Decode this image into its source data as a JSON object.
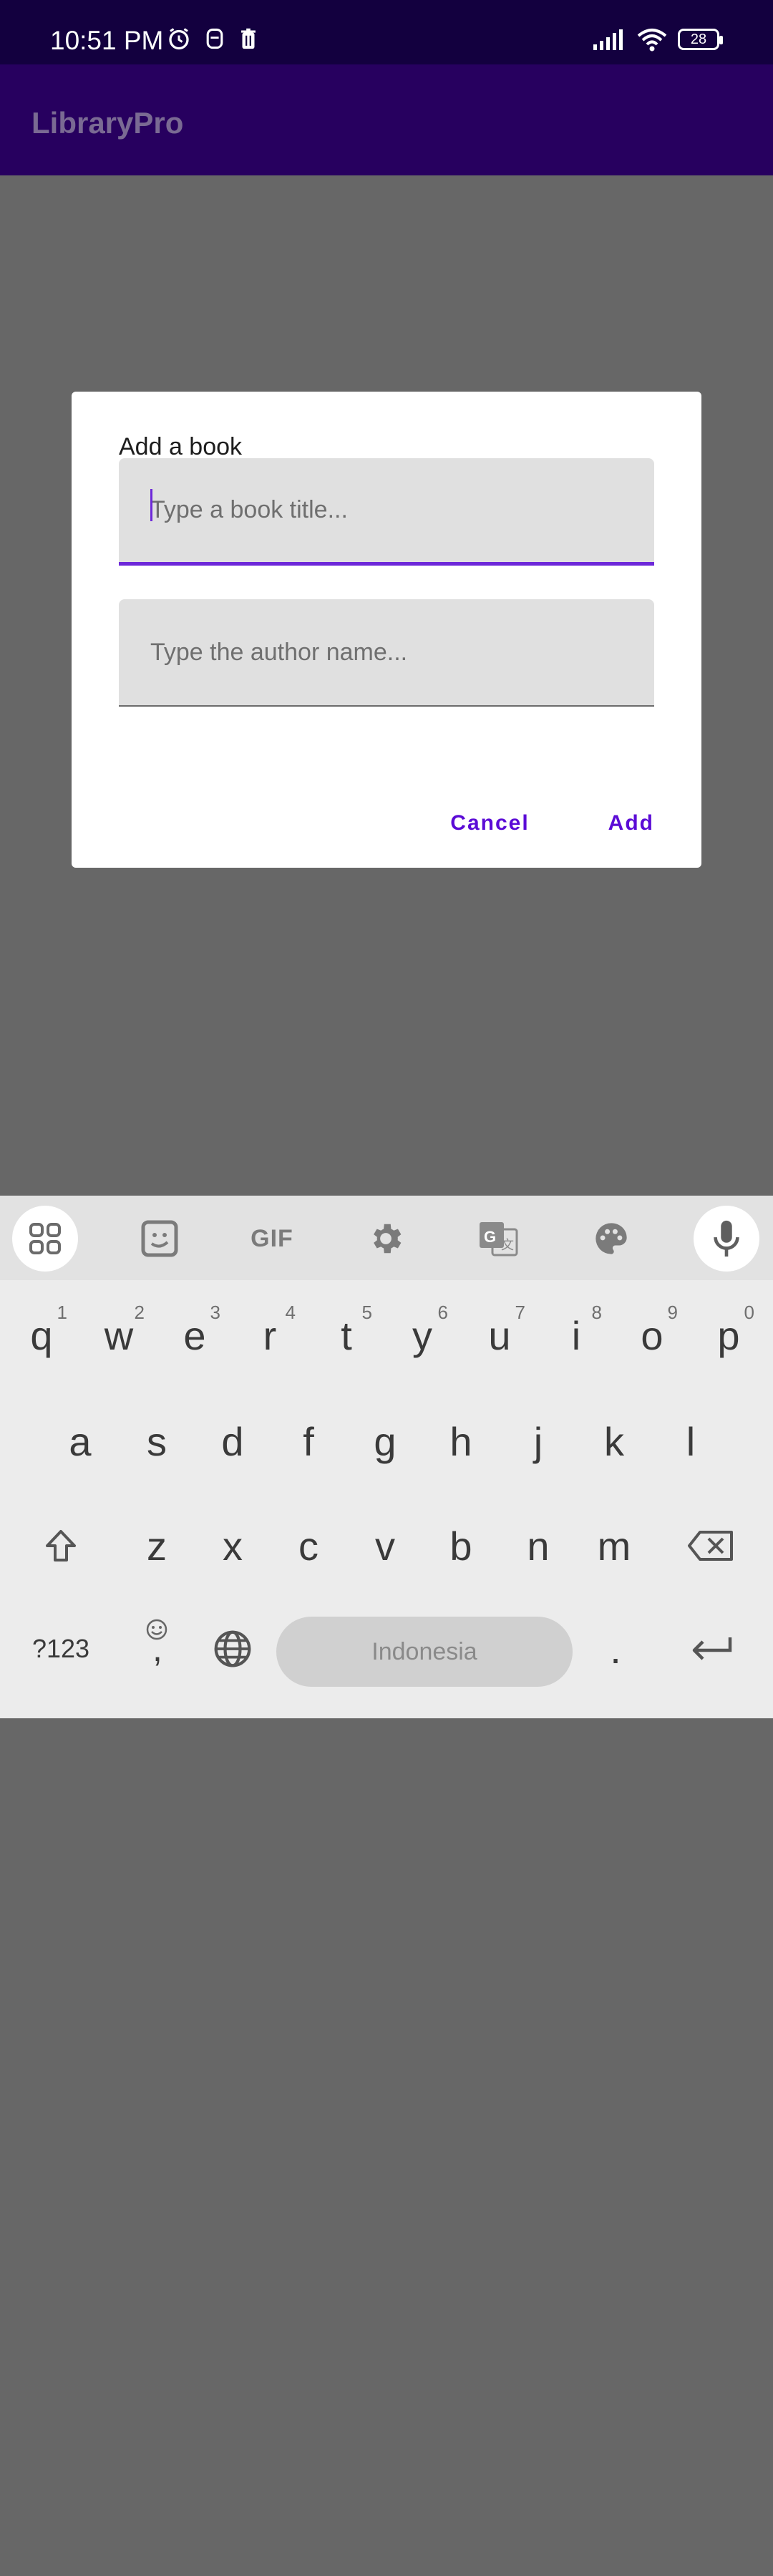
{
  "status_bar": {
    "time": "10:51 PM",
    "battery": "28"
  },
  "app_bar": {
    "title": "LibraryPro"
  },
  "dialog": {
    "title": "Add a book",
    "title_field": {
      "value": "",
      "placeholder": "Type a book title..."
    },
    "author_field": {
      "value": "",
      "placeholder": "Type the author name..."
    },
    "cancel_label": "Cancel",
    "add_label": "Add"
  },
  "keyboard": {
    "toolbar": {
      "gif_label": "GIF"
    },
    "row1": [
      {
        "key": "q",
        "sup": "1"
      },
      {
        "key": "w",
        "sup": "2"
      },
      {
        "key": "e",
        "sup": "3"
      },
      {
        "key": "r",
        "sup": "4"
      },
      {
        "key": "t",
        "sup": "5"
      },
      {
        "key": "y",
        "sup": "6"
      },
      {
        "key": "u",
        "sup": "7"
      },
      {
        "key": "i",
        "sup": "8"
      },
      {
        "key": "o",
        "sup": "9"
      },
      {
        "key": "p",
        "sup": "0"
      }
    ],
    "row2": [
      "a",
      "s",
      "d",
      "f",
      "g",
      "h",
      "j",
      "k",
      "l"
    ],
    "row3": [
      "z",
      "x",
      "c",
      "v",
      "b",
      "n",
      "m"
    ],
    "symbols_label": "?123",
    "comma_label": ",",
    "space_label": "Indonesia",
    "period_label": "."
  },
  "colors": {
    "accent": "#6d28d9",
    "status_bar": "#13003f",
    "app_bar": "#27005f",
    "scrim": "#676767"
  }
}
